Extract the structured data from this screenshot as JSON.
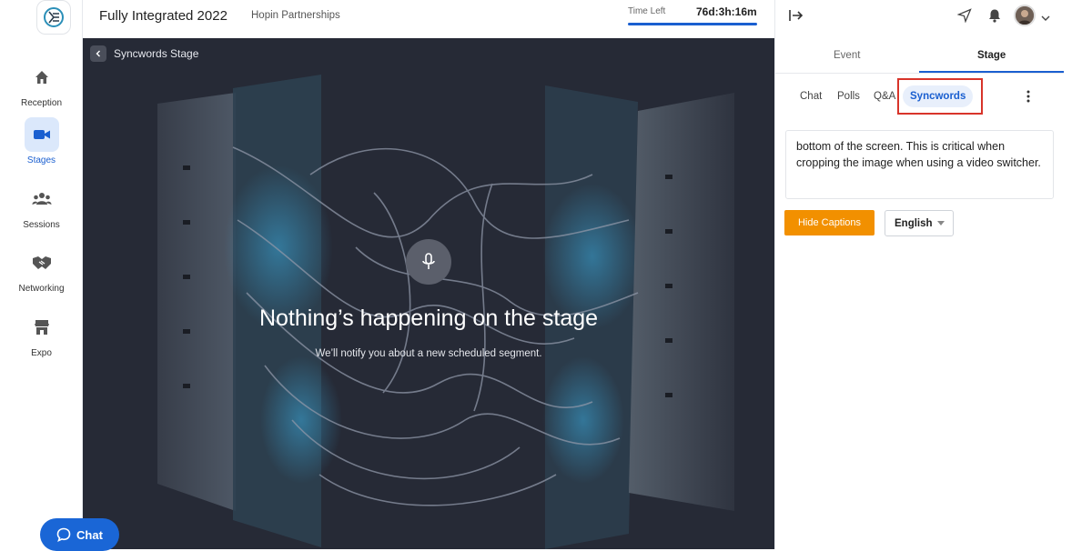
{
  "nav": {
    "items": [
      {
        "label": "Reception",
        "icon": "home-icon"
      },
      {
        "label": "Stages",
        "icon": "video-camera-icon",
        "active": true
      },
      {
        "label": "Sessions",
        "icon": "group-icon"
      },
      {
        "label": "Networking",
        "icon": "handshake-icon"
      },
      {
        "label": "Expo",
        "icon": "storefront-icon"
      }
    ]
  },
  "header": {
    "event_title": "Fully Integrated 2022",
    "org_name": "Hopin Partnerships",
    "time_left_label": "Time Left",
    "time_left_value": "76d:3h:16m"
  },
  "stage": {
    "name": "Syncwords Stage",
    "heading": "Nothing’s happening on the stage",
    "subheading": "We’ll notify you about a new scheduled segment."
  },
  "chat_fab": {
    "label": "Chat"
  },
  "panel": {
    "tabs": {
      "event": "Event",
      "stage": "Stage"
    },
    "subtabs": {
      "chat": "Chat",
      "polls": "Polls",
      "qa": "Q&A",
      "syncwords": "Syncwords"
    },
    "caption_text": "bottom of the screen. This is critical when cropping the image when using a video switcher.",
    "hide_captions": "Hide Captions",
    "language": "English"
  },
  "colors": {
    "accent": "#1a5fd0",
    "caption_button": "#f29000",
    "highlight": "#d8342a",
    "stage_bg": "#262a36"
  }
}
